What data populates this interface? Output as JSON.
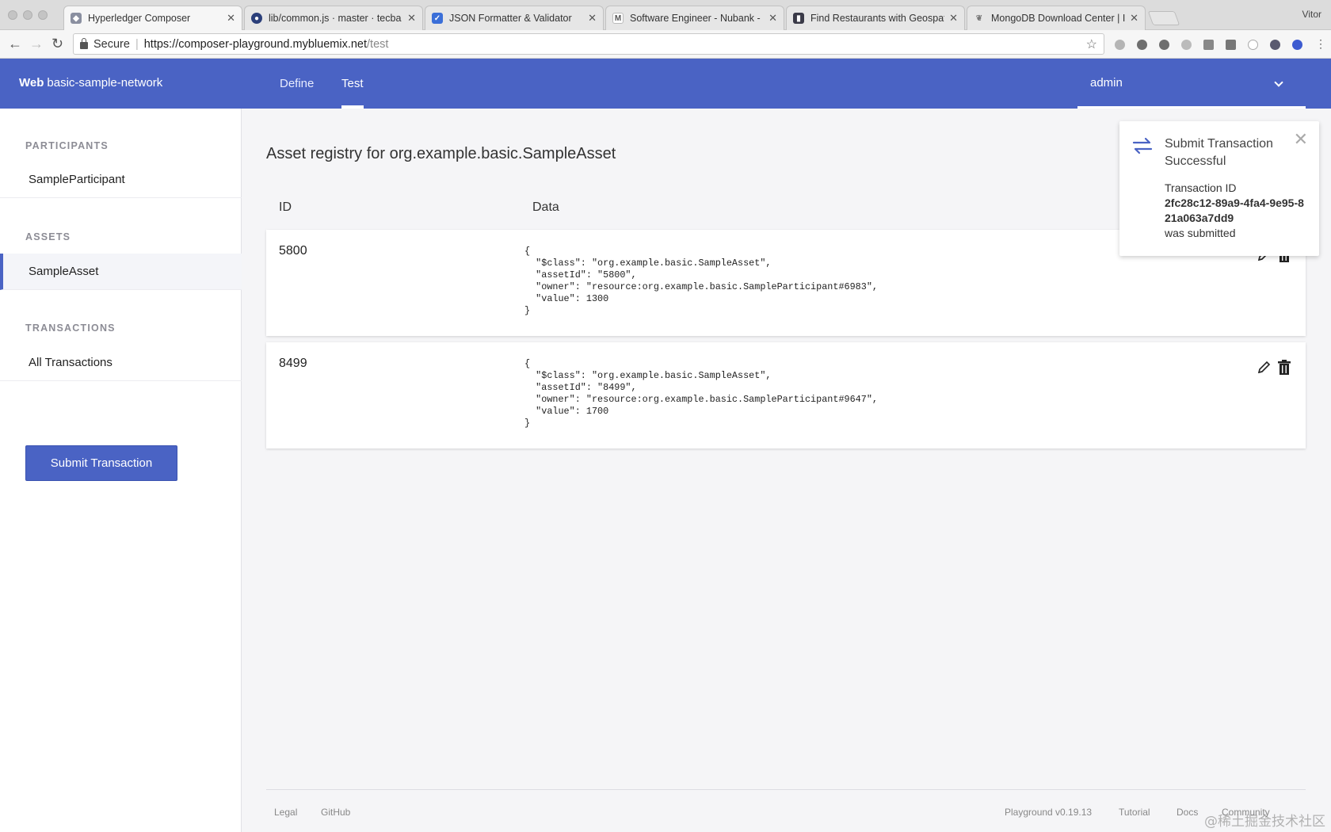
{
  "browser": {
    "tabs": [
      {
        "title": "Hyperledger Composer",
        "active": true,
        "favicon": "cube-icon"
      },
      {
        "title": "lib/common.js · master · tecba",
        "favicon": "github-icon"
      },
      {
        "title": "JSON Formatter & Validator",
        "favicon": "check-icon"
      },
      {
        "title": "Software Engineer - Nubank -",
        "favicon": "gmail-icon"
      },
      {
        "title": "Find Restaurants with Geospat",
        "favicon": "doc-icon"
      },
      {
        "title": "MongoDB Download Center | I",
        "favicon": "mongodb-leaf-icon"
      }
    ],
    "profile_name": "Vitor",
    "secure_label": "Secure",
    "url_main": "https://composer-playground.mybluemix.net",
    "url_path": "/test"
  },
  "app": {
    "brand_bold": "Web",
    "brand_name": "basic-sample-network",
    "nav": {
      "define": "Define",
      "test": "Test"
    },
    "identity": "admin"
  },
  "sidebar": {
    "participants_title": "PARTICIPANTS",
    "participant_item": "SampleParticipant",
    "assets_title": "ASSETS",
    "asset_item": "SampleAsset",
    "transactions_title": "TRANSACTIONS",
    "transactions_item": "All Transactions",
    "submit_button": "Submit Transaction"
  },
  "main": {
    "title": "Asset registry for org.example.basic.SampleAsset",
    "col_id": "ID",
    "col_data": "Data",
    "rows": [
      {
        "id": "5800",
        "json": "{\n  \"$class\": \"org.example.basic.SampleAsset\",\n  \"assetId\": \"5800\",\n  \"owner\": \"resource:org.example.basic.SampleParticipant#6983\",\n  \"value\": 1300\n}"
      },
      {
        "id": "8499",
        "json": "{\n  \"$class\": \"org.example.basic.SampleAsset\",\n  \"assetId\": \"8499\",\n  \"owner\": \"resource:org.example.basic.SampleParticipant#9647\",\n  \"value\": 1700\n}"
      }
    ]
  },
  "footer": {
    "legal": "Legal",
    "github": "GitHub",
    "version": "Playground v0.19.13",
    "tutorial": "Tutorial",
    "docs": "Docs",
    "community": "Community"
  },
  "toast": {
    "title": "Submit Transaction Successful",
    "label": "Transaction ID",
    "tx_id": "2fc28c12-89a9-4fa4-9e95-821a063a7dd9",
    "suffix": "was submitted"
  },
  "watermark": "@稀土掘金技术社区",
  "colors": {
    "brand": "#4a63c4",
    "background": "#f5f5f7"
  }
}
